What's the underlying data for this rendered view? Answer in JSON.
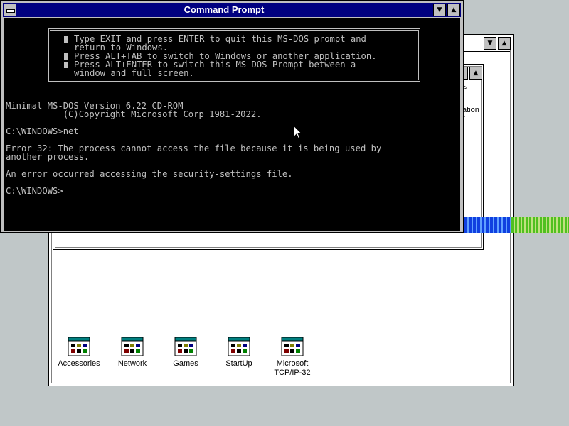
{
  "program_manager": {
    "group_icons": [
      {
        "label": "Accessories"
      },
      {
        "label": "Network"
      },
      {
        "label": "Games"
      },
      {
        "label": "StartUp"
      },
      {
        "label": "Microsoft TCP/IP-32"
      }
    ],
    "peek_text_1": "ation",
    "peek_text_2": "r"
  },
  "command_prompt": {
    "title": "Command Prompt",
    "info_box_lines": [
      "Type EXIT and press ENTER to quit this MS-DOS prompt and",
      "return to Windows.",
      "Press ALT+TAB to switch to Windows or another application.",
      "Press ALT+ENTER to switch this MS-DOS Prompt between a",
      "window and full screen."
    ],
    "console_lines": [
      "Minimal MS-DOS Version 6.22 CD-ROM",
      "           (C)Copyright Microsoft Corp 1981-2022.",
      "",
      "C:\\WINDOWS>net",
      "",
      "Error 32: The process cannot access the file because it is being used by",
      "another process.",
      "",
      "An error occurred accessing the security-settings file.",
      "",
      "C:\\WINDOWS>"
    ]
  },
  "colors": {
    "desktop": "#c0c7c8",
    "titlebar": "#000080",
    "console_bg": "#000000",
    "console_fg": "#c0c0c0"
  },
  "icons": {
    "sysmenu": "system-menu-icon",
    "minimize": "minimize-arrow-icon",
    "maximize": "maximize-arrow-icon",
    "group": "program-group-icon",
    "cursor": "mouse-pointer-icon"
  }
}
